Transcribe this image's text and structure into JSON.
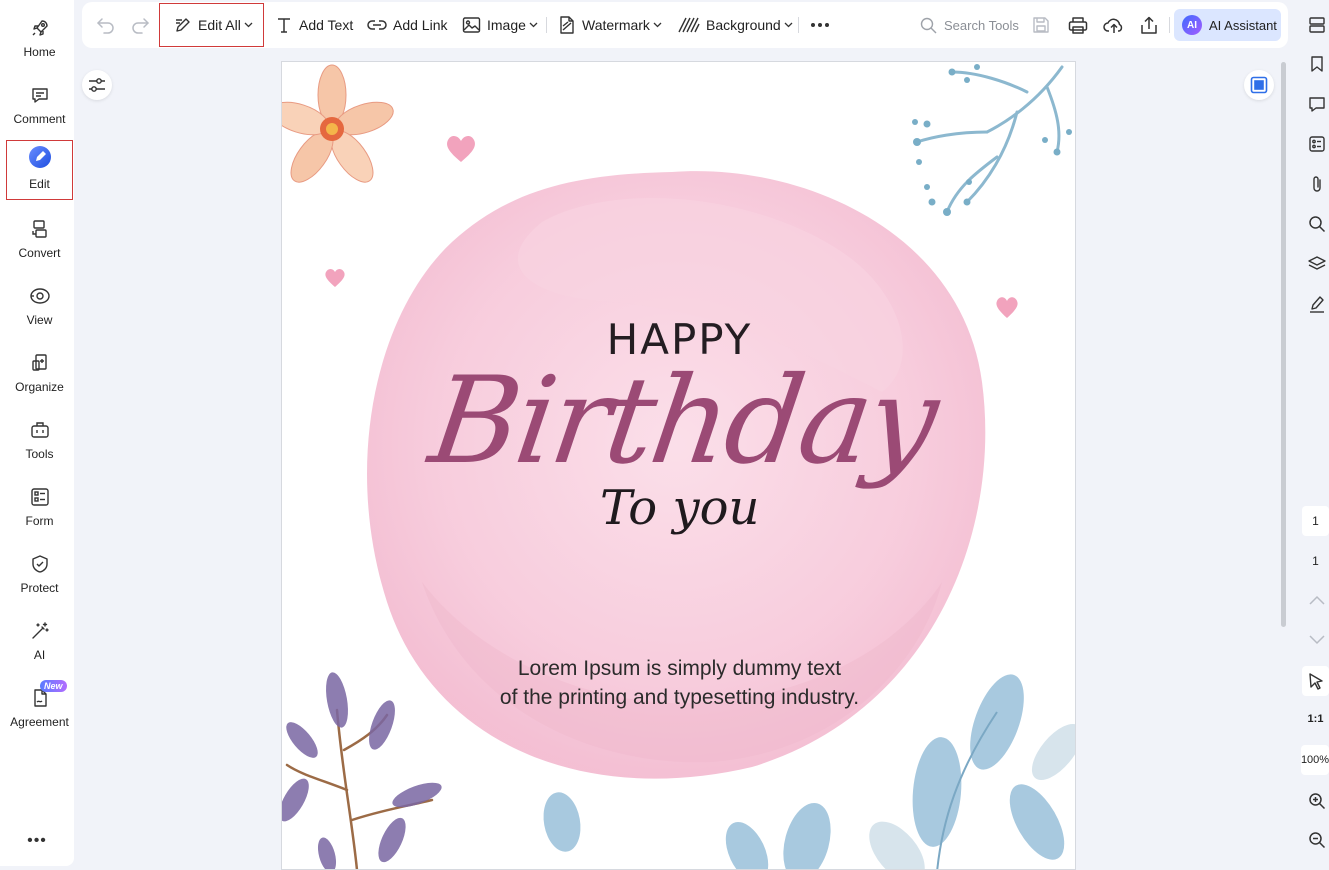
{
  "sidebar": {
    "items": [
      {
        "label": "Home",
        "icon": "rocket-icon"
      },
      {
        "label": "Comment",
        "icon": "comment-icon"
      },
      {
        "label": "Edit",
        "icon": "edit-icon"
      },
      {
        "label": "Convert",
        "icon": "convert-icon"
      },
      {
        "label": "View",
        "icon": "view-icon"
      },
      {
        "label": "Organize",
        "icon": "organize-icon"
      },
      {
        "label": "Tools",
        "icon": "toolbox-icon"
      },
      {
        "label": "Form",
        "icon": "form-icon"
      },
      {
        "label": "Protect",
        "icon": "shield-icon"
      },
      {
        "label": "AI",
        "icon": "magic-wand-icon"
      },
      {
        "label": "Agreement",
        "icon": "agreement-icon",
        "badge": "New"
      }
    ],
    "more": "•••",
    "active": "Edit"
  },
  "toolbar": {
    "edit_all": "Edit All",
    "add_text": "Add Text",
    "add_link": "Add Link",
    "image": "Image",
    "watermark": "Watermark",
    "background": "Background",
    "search_placeholder": "Search Tools",
    "ai_assistant": "AI Assistant",
    "ai_logo": "AI"
  },
  "document": {
    "happy": "HAPPY",
    "birthday": "Birthday",
    "to_you": "To you",
    "body_line1": "Lorem Ipsum is simply dummy text",
    "body_line2": "of the printing and typesetting industry."
  },
  "right_panel": {
    "page_current": "1",
    "page_total": "1",
    "actual_size": "1:1",
    "zoom": "100%"
  },
  "colors": {
    "accent_red_outline": "#d03a3a",
    "birthday_text": "#9b4a75",
    "ai_button_bg": "#dbe6ff",
    "app_background": "#f1f3f9"
  }
}
